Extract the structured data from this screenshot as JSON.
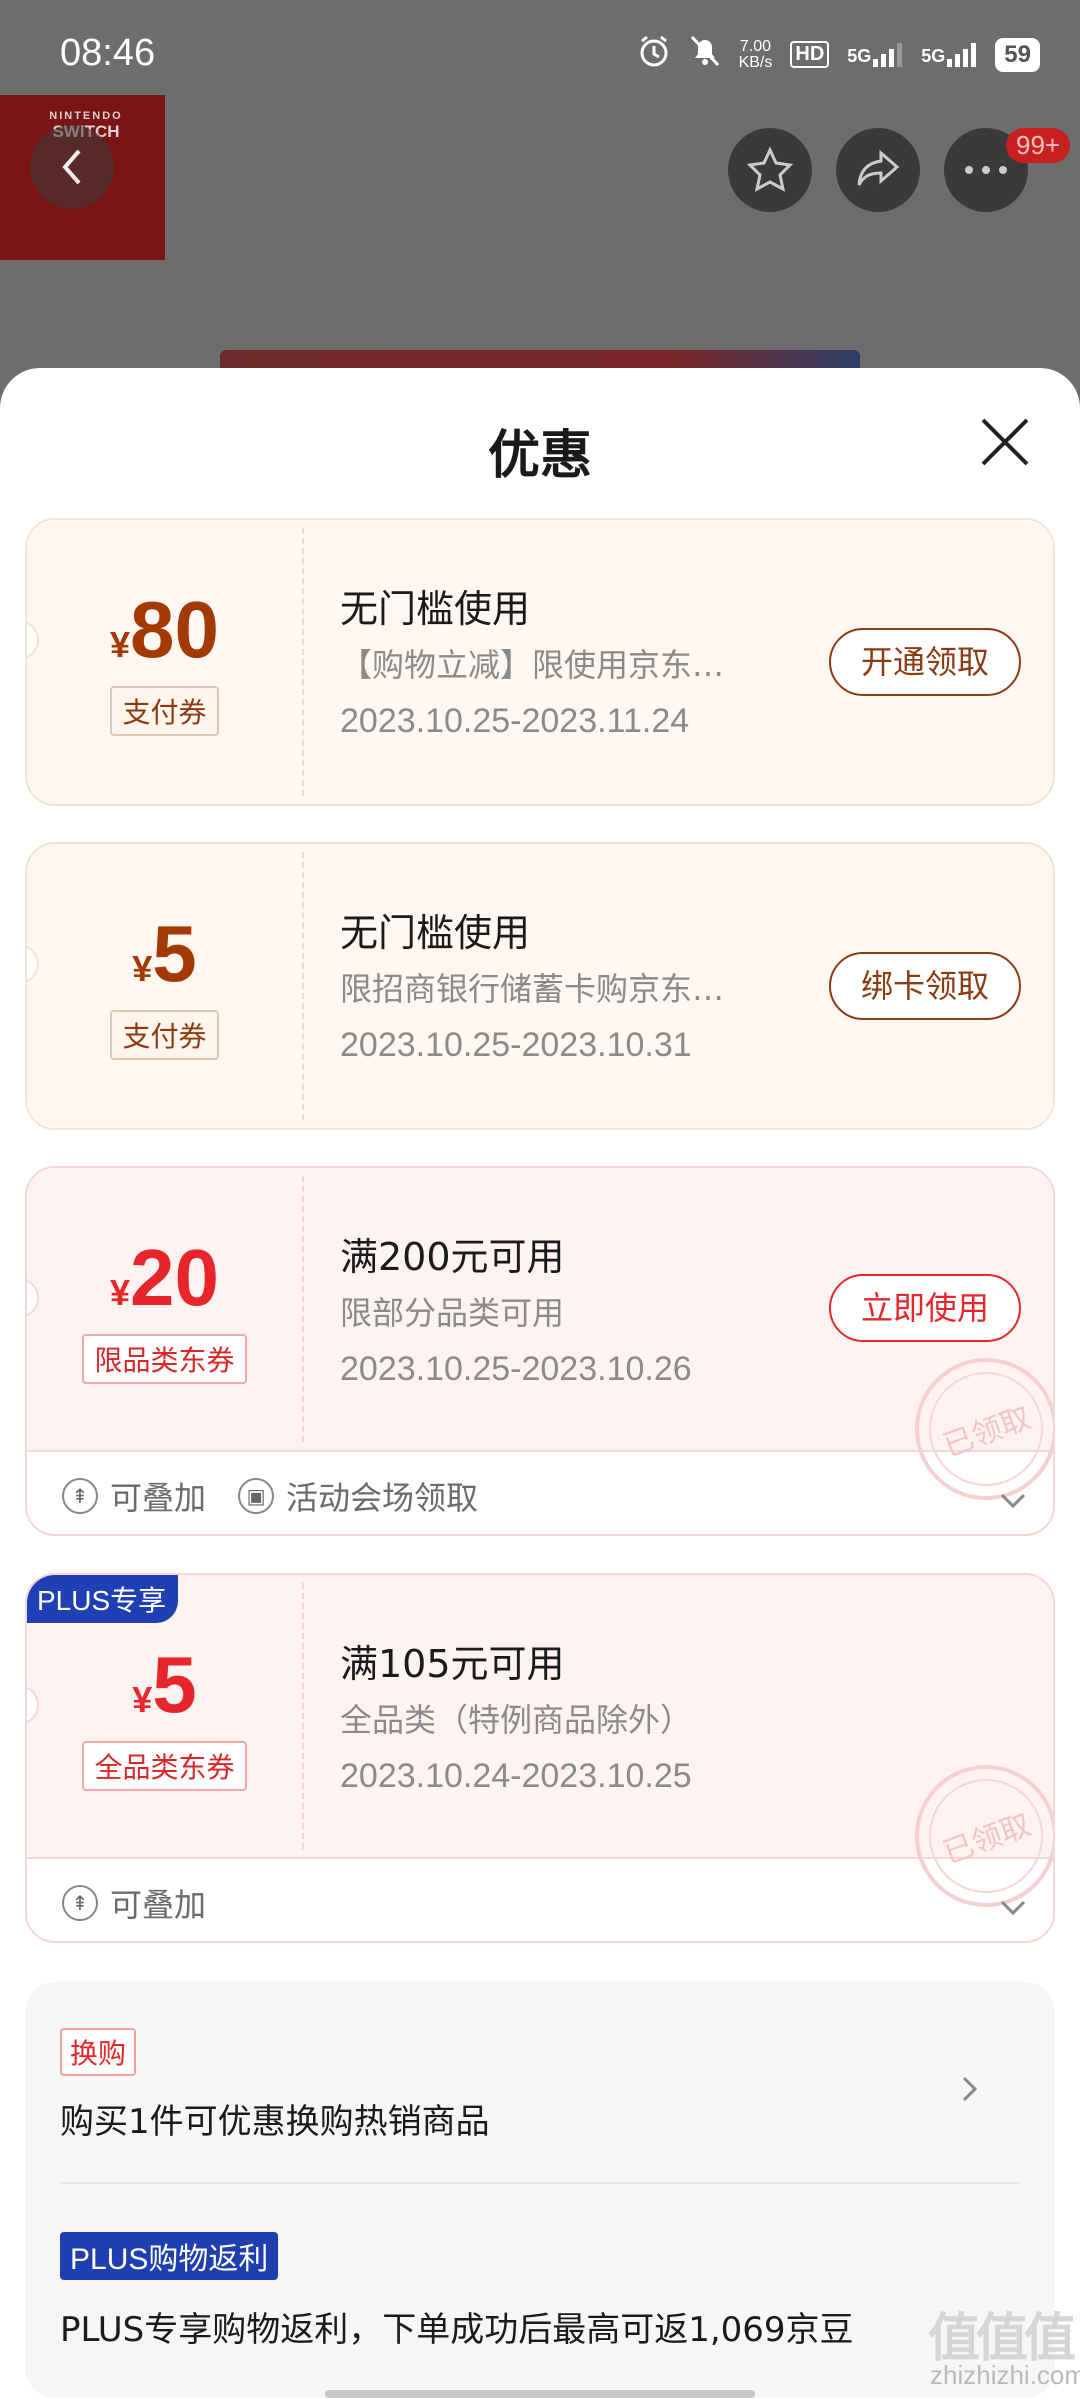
{
  "status_bar": {
    "time": "08:46",
    "net_speed_value": "7.00",
    "net_speed_unit": "KB/s",
    "hd_label": "HD",
    "sim1_label": "5G",
    "sim2_label": "5G",
    "battery": "59"
  },
  "background": {
    "brand_top": "NINTENDO",
    "brand_name": "SWITCH",
    "notification_badge": "99+"
  },
  "sheet": {
    "title": "优惠"
  },
  "coupons": [
    {
      "currency": "¥",
      "amount": "80",
      "type_tag": "支付券",
      "title": "无门槛使用",
      "description": "【购物立减】限使用京东…",
      "date_range": "2023.10.25-2023.11.24",
      "action": "开通领取"
    },
    {
      "currency": "¥",
      "amount": "5",
      "type_tag": "支付券",
      "title": "无门槛使用",
      "description": "限招商银行储蓄卡购京东…",
      "date_range": "2023.10.25-2023.10.31",
      "action": "绑卡领取"
    },
    {
      "currency": "¥",
      "amount": "20",
      "type_tag": "限品类东券",
      "title": "满200元可用",
      "description": "限部分品类可用",
      "date_range": "2023.10.25-2023.10.26",
      "action": "立即使用",
      "stamp": "已领取",
      "footer_stackable": "可叠加",
      "footer_source": "活动会场领取"
    },
    {
      "plus_tag": "PLUS专享",
      "currency": "¥",
      "amount": "5",
      "type_tag": "全品类东券",
      "title": "满105元可用",
      "description": "全品类（特例商品除外）",
      "date_range": "2023.10.24-2023.10.25",
      "stamp": "已领取",
      "footer_stackable": "可叠加"
    }
  ],
  "extras": {
    "exchange_tag": "换购",
    "exchange_text": "购买1件可优惠换购热销商品",
    "plus_rebate_tag": "PLUS购物返利",
    "plus_rebate_text": "PLUS专享购物返利，下单成功后最高可返1,069京豆"
  },
  "watermark": {
    "logo": "值值值",
    "site": "zhizhizhi.com"
  },
  "colors": {
    "orange_accent": "#8a3b10",
    "red_accent": "#e6262a",
    "plus_blue": "#1f40b4"
  }
}
